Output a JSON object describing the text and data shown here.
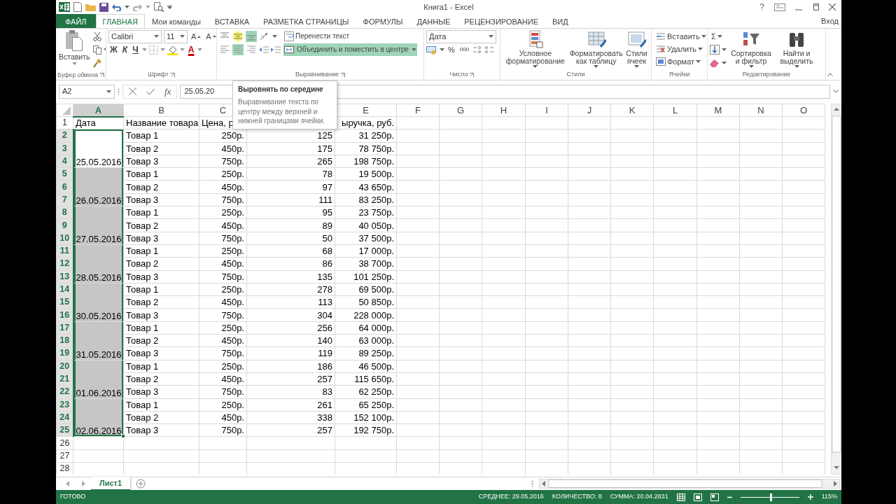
{
  "window": {
    "title": "Книга1 - Excel",
    "help": "?",
    "account": "Вход"
  },
  "tabs": [
    {
      "label": "ФАЙЛ",
      "kind": "file",
      "selected": false
    },
    {
      "label": "ГЛАВНАЯ",
      "kind": "tab",
      "selected": true
    },
    {
      "label": "Мои команды",
      "kind": "tab",
      "selected": false
    },
    {
      "label": "ВСТАВКА",
      "kind": "tab",
      "selected": false
    },
    {
      "label": "РАЗМЕТКА СТРАНИЦЫ",
      "kind": "tab",
      "selected": false
    },
    {
      "label": "ФОРМУЛЫ",
      "kind": "tab",
      "selected": false
    },
    {
      "label": "ДАННЫЕ",
      "kind": "tab",
      "selected": false
    },
    {
      "label": "РЕЦЕНЗИРОВАНИЕ",
      "kind": "tab",
      "selected": false
    },
    {
      "label": "ВИД",
      "kind": "tab",
      "selected": false
    }
  ],
  "ribbon": {
    "clipboard": {
      "paste": "Вставить",
      "label": "Буфер обмена"
    },
    "font": {
      "name": "Calibri",
      "size": "11",
      "grow": "A",
      "shrink": "A",
      "bold": "Ж",
      "italic": "К",
      "underline": "Ч",
      "font_color": "A",
      "label": "Шрифт"
    },
    "alignment": {
      "vertical": [
        {
          "kind": "top",
          "selected": false,
          "hovered": false
        },
        {
          "kind": "middle",
          "selected": false,
          "hovered": true
        },
        {
          "kind": "bottom",
          "selected": true,
          "hovered": false
        }
      ],
      "horizontal": [
        {
          "kind": "left",
          "selected": false
        },
        {
          "kind": "center",
          "selected": true
        },
        {
          "kind": "right",
          "selected": false
        }
      ],
      "wrap_text": {
        "label": "Перенести текст",
        "selected": false
      },
      "merge": {
        "label": "Объединить и поместить в центре",
        "selected": true
      },
      "label": "Выравнивание"
    },
    "number": {
      "format": "Дата",
      "percent": "%",
      "thousands": "000",
      "label": "Число"
    },
    "styles": {
      "buttons": [
        {
          "label": "Условное форматирование",
          "kind": "conditional"
        },
        {
          "label": "Форматировать как таблицу",
          "kind": "table"
        },
        {
          "label": "Стили ячеек",
          "kind": "cell"
        }
      ],
      "label": "Стили"
    },
    "cells": {
      "buttons": [
        {
          "label": "Вставить",
          "kind": "insert"
        },
        {
          "label": "Удалить",
          "kind": "delete"
        },
        {
          "label": "Формат",
          "kind": "format"
        }
      ],
      "label": "Ячейки"
    },
    "editing": {
      "autosum": "Σ",
      "sort": "Сортировка и фильтр",
      "find": "Найти и выделить",
      "label": "Редактирование"
    }
  },
  "formula_bar": {
    "name_box": "A2",
    "fx": "fx",
    "value": "25.05.20"
  },
  "tooltip": {
    "title": "Выровнять по середине",
    "text": "Выравнивание текста по центру между верхней и нижней границами ячейки."
  },
  "sheet": {
    "columns": [
      {
        "label": "A",
        "selected": true
      },
      {
        "label": "B",
        "selected": false
      },
      {
        "label": "C",
        "selected": false
      },
      null,
      {
        "label": "E",
        "selected": false
      },
      {
        "label": "F",
        "selected": false
      },
      {
        "label": "G",
        "selected": false
      },
      {
        "label": "H",
        "selected": false
      },
      {
        "label": "I",
        "selected": false
      },
      {
        "label": "J",
        "selected": false
      },
      {
        "label": "K",
        "selected": false
      },
      {
        "label": "L",
        "selected": false
      },
      {
        "label": "M",
        "selected": false
      },
      {
        "label": "N",
        "selected": false
      },
      {
        "label": "O",
        "selected": false
      }
    ],
    "header_row": {
      "row": "1",
      "cells": [
        "Дата",
        "Название товара",
        "Цена, р",
        null,
        "ыручка, руб."
      ]
    },
    "groups": [
      {
        "date": "25.05.2016",
        "selected": true,
        "active": true,
        "rows": [
          {
            "row": "2",
            "cells": [
              "Товар 1",
              "250р.",
              "125",
              "31 250р."
            ]
          },
          {
            "row": "3",
            "cells": [
              "Товар 2",
              "450р.",
              "175",
              "78 750р."
            ]
          },
          {
            "row": "4",
            "cells": [
              "Товар 3",
              "750р.",
              "265",
              "198 750р."
            ]
          }
        ]
      },
      {
        "date": "26.05.2016",
        "selected": true,
        "active": false,
        "rows": [
          {
            "row": "5",
            "cells": [
              "Товар 1",
              "250р.",
              "78",
              "19 500р."
            ]
          },
          {
            "row": "6",
            "cells": [
              "Товар 2",
              "450р.",
              "97",
              "43 650р."
            ]
          },
          {
            "row": "7",
            "cells": [
              "Товар 3",
              "750р.",
              "111",
              "83 250р."
            ]
          }
        ]
      },
      {
        "date": "27.05.2016",
        "selected": true,
        "active": false,
        "rows": [
          {
            "row": "8",
            "cells": [
              "Товар 1",
              "250р.",
              "95",
              "23 750р."
            ]
          },
          {
            "row": "9",
            "cells": [
              "Товар 2",
              "450р.",
              "89",
              "40 050р."
            ]
          },
          {
            "row": "10",
            "cells": [
              "Товар 3",
              "750р.",
              "50",
              "37 500р."
            ]
          }
        ]
      },
      {
        "date": "28.05.2016",
        "selected": true,
        "active": false,
        "rows": [
          {
            "row": "11",
            "cells": [
              "Товар 1",
              "250р.",
              "68",
              "17 000р."
            ]
          },
          {
            "row": "12",
            "cells": [
              "Товар 2",
              "450р.",
              "86",
              "38 700р."
            ]
          },
          {
            "row": "13",
            "cells": [
              "Товар 3",
              "750р.",
              "135",
              "101 250р."
            ]
          }
        ]
      },
      {
        "date": "30.05.2016",
        "selected": true,
        "active": false,
        "rows": [
          {
            "row": "14",
            "cells": [
              "Товар 1",
              "250р.",
              "278",
              "69 500р."
            ]
          },
          {
            "row": "15",
            "cells": [
              "Товар 2",
              "450р.",
              "113",
              "50 850р."
            ]
          },
          {
            "row": "16",
            "cells": [
              "Товар 3",
              "750р.",
              "304",
              "228 000р."
            ]
          }
        ]
      },
      {
        "date": "31.05.2016",
        "selected": true,
        "active": false,
        "rows": [
          {
            "row": "17",
            "cells": [
              "Товар 1",
              "250р.",
              "256",
              "64 000р."
            ]
          },
          {
            "row": "18",
            "cells": [
              "Товар 2",
              "450р.",
              "140",
              "63 000р."
            ]
          },
          {
            "row": "19",
            "cells": [
              "Товар 3",
              "750р.",
              "119",
              "89 250р."
            ]
          }
        ]
      },
      {
        "date": "01.06.2016",
        "selected": true,
        "active": false,
        "rows": [
          {
            "row": "20",
            "cells": [
              "Товар 1",
              "250р.",
              "186",
              "46 500р."
            ]
          },
          {
            "row": "21",
            "cells": [
              "Товар 2",
              "450р.",
              "257",
              "115 650р."
            ]
          },
          {
            "row": "22",
            "cells": [
              "Товар 3",
              "750р.",
              "83",
              "62 250р."
            ]
          }
        ]
      },
      {
        "date": "02.06.2016",
        "selected": true,
        "active": false,
        "rows": [
          {
            "row": "23",
            "cells": [
              "Товар 1",
              "250р.",
              "261",
              "65 250р."
            ]
          },
          {
            "row": "24",
            "cells": [
              "Товар 2",
              "450р.",
              "338",
              "152 100р."
            ]
          },
          {
            "row": "25",
            "cells": [
              "Товар 3",
              "750р.",
              "257",
              "192 750р."
            ]
          }
        ]
      }
    ],
    "empty_rows": [
      "26",
      "27",
      "28"
    ]
  },
  "sheet_tabs": [
    {
      "label": "Лист1",
      "selected": true
    }
  ],
  "status_bar": {
    "mode": "ГОТОВО",
    "average": "СРЕДНЕЕ: 29.05.2016",
    "count": "КОЛИЧЕСТВО: 8",
    "sum": "СУММА: 20.04.2831",
    "zoom": "115%",
    "level": 0.52
  }
}
